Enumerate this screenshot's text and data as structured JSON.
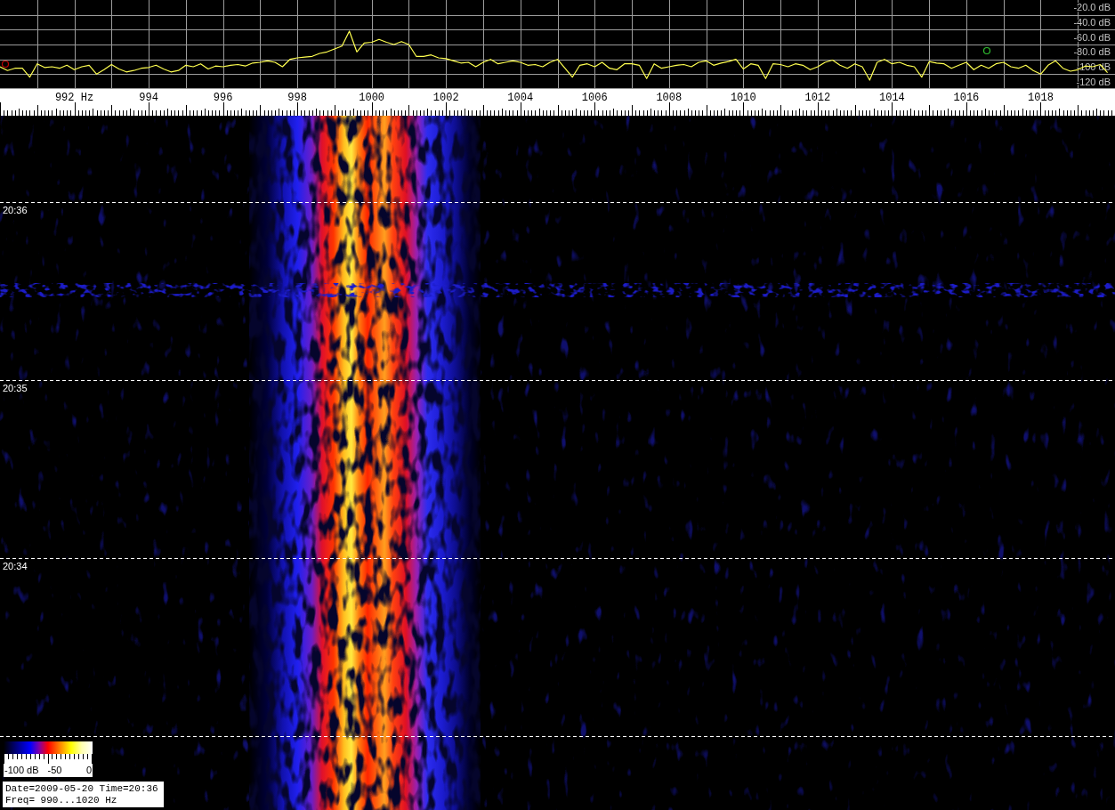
{
  "spectrum": {
    "chart_data": {
      "type": "line",
      "grid": true,
      "xlim": [
        990,
        1020
      ],
      "ylim": [
        -120,
        0
      ],
      "xticks": [
        {
          "value": 992,
          "label": "992 Hz"
        },
        994,
        996,
        998,
        1000,
        1002,
        1004,
        1006,
        1008,
        1010,
        1012,
        1014,
        1016,
        1018
      ],
      "yticks": [
        {
          "value": -20,
          "label": "-20.0 dB"
        },
        {
          "value": -40,
          "label": "-40.0 dB"
        },
        {
          "value": -60,
          "label": "-60.0 dB"
        },
        {
          "value": -80,
          "label": "-80.0 dB"
        },
        {
          "value": -100,
          "label": "-100 dB"
        },
        {
          "value": -120,
          "label": "-120 dB"
        }
      ],
      "x": [
        990,
        990.2,
        990.4,
        990.6,
        990.8,
        991,
        991.2,
        991.4,
        991.6,
        991.8,
        992,
        992.2,
        992.4,
        992.6,
        992.8,
        993,
        993.2,
        993.4,
        993.6,
        993.8,
        994,
        994.2,
        994.4,
        994.6,
        994.8,
        995,
        995.2,
        995.4,
        995.6,
        995.8,
        996,
        996.2,
        996.4,
        996.6,
        996.8,
        997,
        997.2,
        997.4,
        997.6,
        997.8,
        998,
        998.2,
        998.4,
        998.6,
        998.8,
        999,
        999.2,
        999.4,
        999.6,
        999.8,
        1000,
        1000.2,
        1000.4,
        1000.6,
        1000.8,
        1001,
        1001.2,
        1001.4,
        1001.6,
        1001.8,
        1002,
        1002.2,
        1002.4,
        1002.6,
        1002.8,
        1003,
        1003.2,
        1003.4,
        1003.6,
        1003.8,
        1004,
        1004.2,
        1004.4,
        1004.6,
        1004.8,
        1005,
        1005.2,
        1005.4,
        1005.6,
        1005.8,
        1006,
        1006.2,
        1006.4,
        1006.6,
        1006.8,
        1007,
        1007.2,
        1007.4,
        1007.6,
        1007.8,
        1008,
        1008.2,
        1008.4,
        1008.6,
        1008.8,
        1009,
        1009.2,
        1009.4,
        1009.6,
        1009.8,
        1010,
        1010.2,
        1010.4,
        1010.6,
        1010.8,
        1011,
        1011.2,
        1011.4,
        1011.6,
        1011.8,
        1012,
        1012.2,
        1012.4,
        1012.6,
        1012.8,
        1013,
        1013.2,
        1013.4,
        1013.6,
        1013.8,
        1014,
        1014.2,
        1014.4,
        1014.6,
        1014.8,
        1015,
        1015.2,
        1015.4,
        1015.6,
        1015.8,
        1016,
        1016.2,
        1016.4,
        1016.6,
        1016.8,
        1017,
        1017.2,
        1017.4,
        1017.6,
        1017.8,
        1018,
        1018.2,
        1018.4,
        1018.6,
        1018.8,
        1019,
        1019.2,
        1019.4,
        1019.6,
        1019.8
      ],
      "series": [
        {
          "color": "#ffff50",
          "values": [
            -90,
            -95,
            -92,
            -92,
            -104,
            -86,
            -91,
            -90,
            -92,
            -88,
            -94,
            -90,
            -88,
            -100,
            -94,
            -87,
            -93,
            -97,
            -95,
            -92,
            -91,
            -88,
            -93,
            -97,
            -95,
            -88,
            -90,
            -86,
            -93,
            -89,
            -90,
            -88,
            -87,
            -89,
            -85,
            -84,
            -82,
            -84,
            -90,
            -80,
            -78,
            -77,
            -76,
            -72,
            -70,
            -66,
            -62,
            -42,
            -70,
            -58,
            -57,
            -53,
            -57,
            -60,
            -56,
            -60,
            -76,
            -76,
            -74,
            -78,
            -79,
            -82,
            -85,
            -84,
            -90,
            -84,
            -80,
            -86,
            -84,
            -82,
            -84,
            -88,
            -87,
            -90,
            -84,
            -80,
            -92,
            -104,
            -88,
            -86,
            -90,
            -84,
            -92,
            -94,
            -86,
            -86,
            -88,
            -106,
            -86,
            -92,
            -90,
            -88,
            -87,
            -90,
            -84,
            -82,
            -88,
            -85,
            -83,
            -80,
            -93,
            -86,
            -88,
            -106,
            -86,
            -87,
            -90,
            -86,
            -88,
            -94,
            -90,
            -84,
            -81,
            -88,
            -92,
            -86,
            -90,
            -108,
            -84,
            -80,
            -86,
            -84,
            -88,
            -90,
            -104,
            -83,
            -85,
            -86,
            -92,
            -88,
            -84,
            -94,
            -88,
            -92,
            -86,
            -84,
            -90,
            -92,
            -88,
            -95,
            -100,
            -88,
            -82,
            -92,
            -96,
            -94,
            -89,
            -90,
            -87,
            -98
          ]
        }
      ]
    }
  },
  "waterfall": {
    "time_labels": [
      "20:36",
      "20:35",
      "20:34"
    ]
  },
  "color_scale": {
    "labels": [
      "-100 dB",
      "-50",
      "0"
    ]
  },
  "info_box": {
    "lines": [
      "Date=2009-05-20 Time=20:36",
      "Freq= 990...1020 Hz"
    ]
  }
}
